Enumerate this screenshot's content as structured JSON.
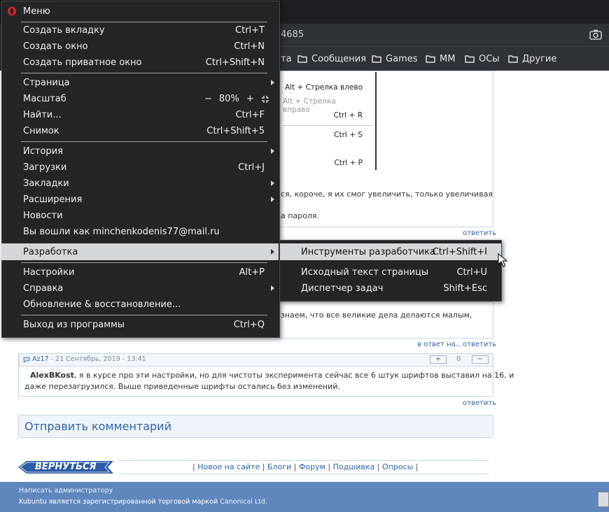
{
  "browser": {
    "address_fragment": "4685",
    "bookmarks": [
      "та",
      "Сообщения",
      "Games",
      "MM",
      "ОСы",
      "Другие"
    ]
  },
  "page": {
    "screenshot_menu": {
      "items": [
        "Alt + Стрелка влево",
        "Alt + Стрелка вправо",
        "Ctrl + R",
        "Ctrl + S",
        "Ctrl + P"
      ]
    },
    "comment1": {
      "fragment1": "ся, короче, я их смог увеличить, только увеличивая",
      "fragment2": "а пароля.",
      "reply": "ответить"
    },
    "comment2": {
      "fragment": "знаем, что все великие дела делаются малым,",
      "in_reply": "в ответ на...",
      "reply": "ответить"
    },
    "comment3": {
      "author": "Az17",
      "date": "- 21 Сентябрь, 2019 - 13:41",
      "vote_plus": "+",
      "vote_count": "0",
      "vote_minus": "−",
      "addressee": "AlexBKost",
      "line1": ", я в курсе про эти настройки, но для чистоты эксперимента сейчас все 6 штук шрифтов выставил на 16, и",
      "line2": "даже перезагрузился. Выше приведенные шрифты остались без изменений.",
      "reply": "ответить"
    },
    "send_comment": "Отправить комментарий",
    "back_button": "ВЕРНУТЬСЯ",
    "footer_links": [
      "Новое на сайте",
      "Блоги",
      "Форум",
      "Подшивка",
      "Опросы"
    ],
    "footer": {
      "line1": "Написать администратору",
      "line2_prefix": "Kubuntu является зарегистрированной торговой маркой",
      "line2_link": "Canonical Ltd."
    }
  },
  "menu": {
    "title": "Меню",
    "new_tab": {
      "label": "Создать вкладку",
      "shortcut": "Ctrl+T"
    },
    "new_window": {
      "label": "Создать окно",
      "shortcut": "Ctrl+N"
    },
    "new_private": {
      "label": "Создать приватное окно",
      "shortcut": "Ctrl+Shift+N"
    },
    "page": {
      "label": "Страница"
    },
    "zoom": {
      "label": "Масштаб",
      "minus": "−",
      "value": "80%",
      "plus": "+"
    },
    "find": {
      "label": "Найти...",
      "shortcut": "Ctrl+F"
    },
    "snapshot": {
      "label": "Снимок",
      "shortcut": "Ctrl+Shift+5"
    },
    "history": {
      "label": "История"
    },
    "downloads": {
      "label": "Загрузки",
      "shortcut": "Ctrl+J"
    },
    "bookmarks": {
      "label": "Закладки"
    },
    "extensions": {
      "label": "Расширения"
    },
    "news": {
      "label": "Новости"
    },
    "signed_in": {
      "label": "Вы вошли как minchenkodenis77@mail.ru"
    },
    "developer": {
      "label": "Разработка"
    },
    "settings": {
      "label": "Настройки",
      "shortcut": "Alt+P"
    },
    "help": {
      "label": "Справка"
    },
    "update": {
      "label": "Обновление & восстановление..."
    },
    "exit": {
      "label": "Выход из программы",
      "shortcut": "Ctrl+Q"
    }
  },
  "submenu": {
    "dev_tools": {
      "label": "Инструменты разработчика",
      "shortcut": "Ctrl+Shift+I"
    },
    "page_source": {
      "label": "Исходный текст страницы",
      "shortcut": "Ctrl+U"
    },
    "task_manager": {
      "label": "Диспетчер задач",
      "shortcut": "Shift+Esc"
    }
  }
}
